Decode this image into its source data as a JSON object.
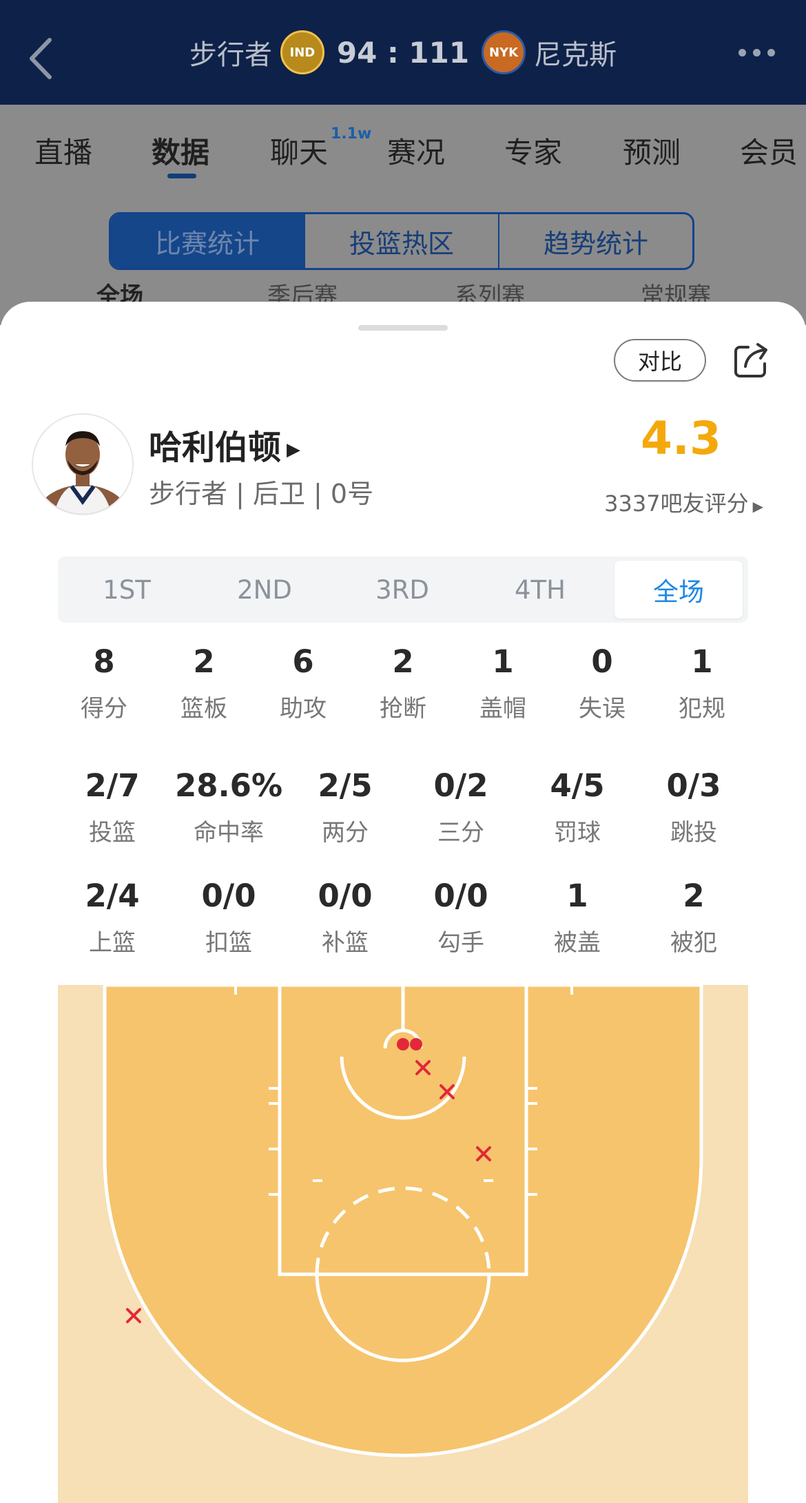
{
  "header": {
    "home_team": "步行者",
    "home_logo_text": "IND",
    "score": "94 : 111",
    "away_logo_text": "NYK",
    "away_team": "尼克斯"
  },
  "tabs": [
    {
      "label": "直播"
    },
    {
      "label": "数据"
    },
    {
      "label": "聊天",
      "badge": "1.1w"
    },
    {
      "label": "赛况"
    },
    {
      "label": "专家"
    },
    {
      "label": "预测"
    },
    {
      "label": "会员"
    }
  ],
  "segments": [
    "比赛统计",
    "投篮热区",
    "趋势统计"
  ],
  "filters": [
    "全场",
    "季后赛",
    "系列赛",
    "常规赛"
  ],
  "sheet": {
    "compare_label": "对比",
    "player_name": "哈利伯顿",
    "player_meta": "步行者 | 后卫 | 0号",
    "rating": "4.3",
    "rating_count": "3337吧友评分",
    "periods": [
      "1ST",
      "2ND",
      "3RD",
      "4TH",
      "全场"
    ],
    "selected_period": "全场",
    "stats_row1": [
      {
        "value": "8",
        "label": "得分"
      },
      {
        "value": "2",
        "label": "篮板"
      },
      {
        "value": "6",
        "label": "助攻"
      },
      {
        "value": "2",
        "label": "抢断"
      },
      {
        "value": "1",
        "label": "盖帽"
      },
      {
        "value": "0",
        "label": "失误"
      },
      {
        "value": "1",
        "label": "犯规"
      }
    ],
    "stats_row2": [
      {
        "value": "2/7",
        "label": "投篮"
      },
      {
        "value": "28.6%",
        "label": "命中率"
      },
      {
        "value": "2/5",
        "label": "两分"
      },
      {
        "value": "0/2",
        "label": "三分"
      },
      {
        "value": "4/5",
        "label": "罚球"
      },
      {
        "value": "0/3",
        "label": "跳投"
      }
    ],
    "stats_row3": [
      {
        "value": "2/4",
        "label": "上篮"
      },
      {
        "value": "0/0",
        "label": "扣篮"
      },
      {
        "value": "0/0",
        "label": "补篮"
      },
      {
        "value": "0/0",
        "label": "勾手"
      },
      {
        "value": "1",
        "label": "被盖"
      },
      {
        "value": "2",
        "label": "被犯"
      }
    ]
  },
  "shot_chart": {
    "made_count": 2,
    "missed_count": 5,
    "made_color": "#e2283a",
    "missed_color": "#e2283a",
    "court_color": "#f6c46c",
    "outside_color": "#f7dfb6"
  },
  "icons": [
    "back-arrow-icon",
    "more-icon",
    "share-icon"
  ]
}
